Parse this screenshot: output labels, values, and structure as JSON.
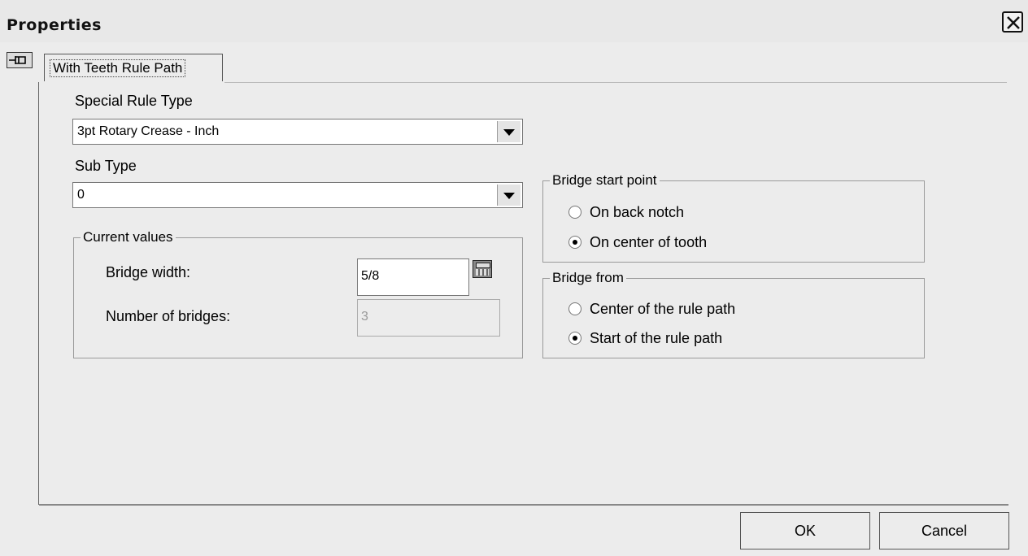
{
  "window": {
    "title": "Properties"
  },
  "tab": {
    "label": "With Teeth Rule Path"
  },
  "special_rule_type": {
    "label": "Special Rule Type",
    "value": "3pt Rotary Crease - Inch"
  },
  "sub_type": {
    "label": "Sub Type",
    "value": "0"
  },
  "current_values": {
    "title": "Current values",
    "bridge_width_label": "Bridge width:",
    "bridge_width_value": "5/8",
    "number_of_bridges_label": "Number of bridges:",
    "number_of_bridges_value": "3"
  },
  "bridge_start_point": {
    "title": "Bridge start point",
    "options": [
      {
        "label": "On back notch",
        "selected": false
      },
      {
        "label": "On center of tooth",
        "selected": true
      }
    ]
  },
  "bridge_from": {
    "title": "Bridge from",
    "options": [
      {
        "label": "Center of the rule path",
        "selected": false
      },
      {
        "label": "Start of the rule path",
        "selected": true
      }
    ]
  },
  "buttons": {
    "ok": "OK",
    "cancel": "Cancel"
  }
}
